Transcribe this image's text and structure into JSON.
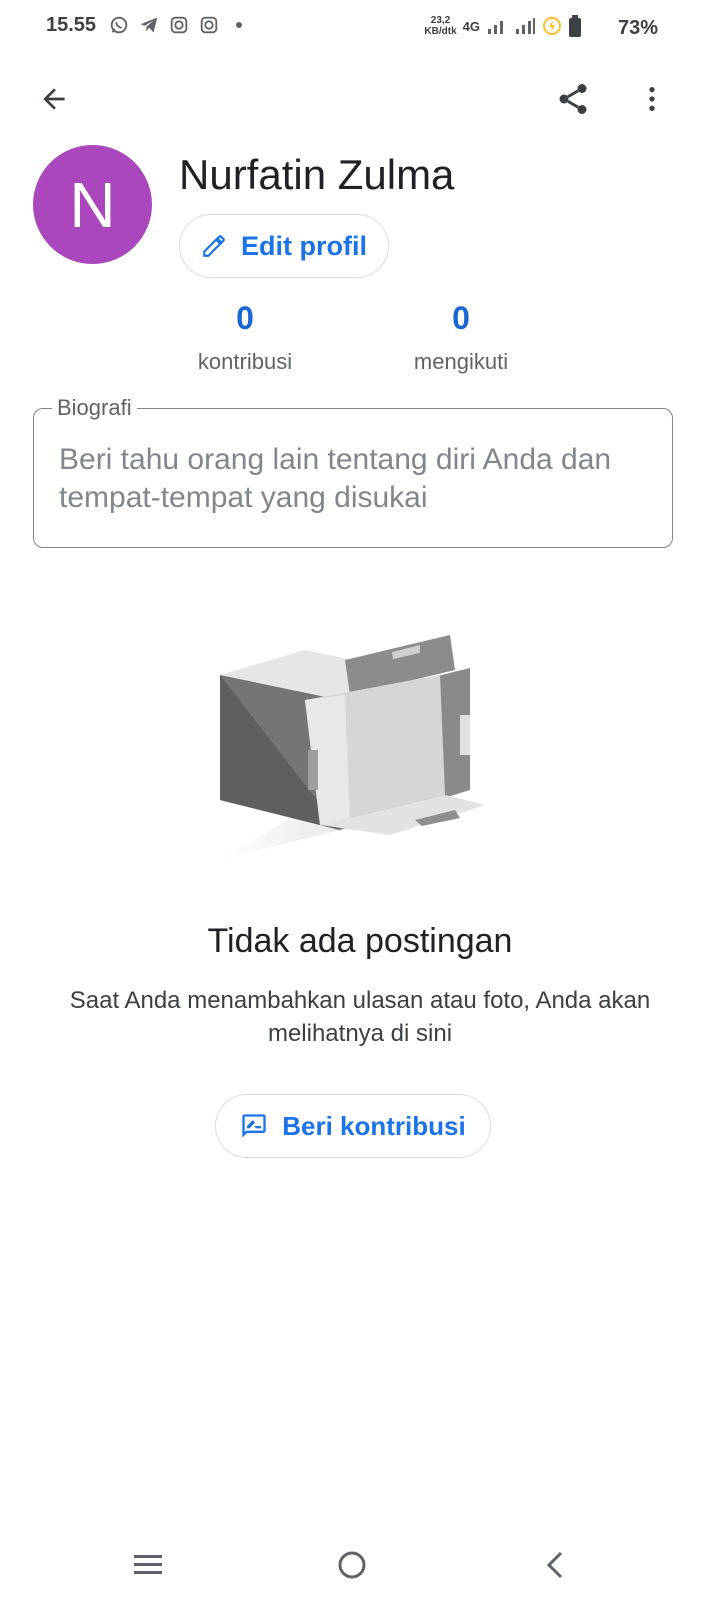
{
  "status_bar": {
    "time": "15.55",
    "network_speed_value": "23,2",
    "network_speed_unit": "KB/dtk",
    "network_type": "4G",
    "battery_percent": "73%"
  },
  "profile": {
    "avatar_letter": "N",
    "avatar_color": "#ab47bc",
    "name": "Nurfatin Zulma",
    "edit_button_label": "Edit profil"
  },
  "stats": [
    {
      "value": "0",
      "label": "kontribusi"
    },
    {
      "value": "0",
      "label": "mengikuti"
    }
  ],
  "bio": {
    "label": "Biografi",
    "placeholder": "Beri tahu orang lain tentang diri Anda dan tempat-tempat yang disukai"
  },
  "empty_state": {
    "title": "Tidak ada postingan",
    "description": "Saat Anda menambahkan ulasan atau foto, Anda akan melihatnya di sini",
    "button_label": "Beri kontribusi"
  },
  "icons": {
    "back": "arrow-back-icon",
    "share": "share-icon",
    "more": "more-vert-icon",
    "edit": "pencil-icon",
    "contribute": "rate-review-icon",
    "nav_recents": "recents-icon",
    "nav_home": "home-icon",
    "nav_back": "nav-back-icon"
  },
  "colors": {
    "accent": "#1a73e8",
    "stat_value": "#1967d2"
  }
}
